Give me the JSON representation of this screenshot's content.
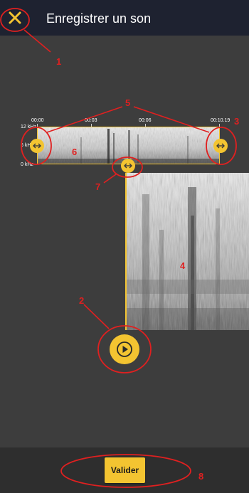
{
  "header": {
    "title": "Enregistrer un son"
  },
  "timeline": {
    "ticks": [
      "00:00",
      "00:03",
      "00:06",
      "00:10.19"
    ],
    "freq_labels": [
      "12 kHz",
      "6 kHz",
      "0 kHz"
    ]
  },
  "footer": {
    "validate_label": "Valider"
  },
  "annotations": [
    "1",
    "2",
    "3",
    "4",
    "5",
    "6",
    "7",
    "8"
  ],
  "colors": {
    "accent": "#f3c431",
    "app_bar": "#1e2230",
    "background": "#3d3d3d",
    "bottom_bar": "#2e2e2e",
    "annotation": "#e02020"
  },
  "icons": {
    "close": "close-icon",
    "left_handle": "horizontal-resize-icon",
    "right_handle": "horizontal-resize-icon",
    "center_handle": "horizontal-resize-icon",
    "play": "play-icon"
  }
}
